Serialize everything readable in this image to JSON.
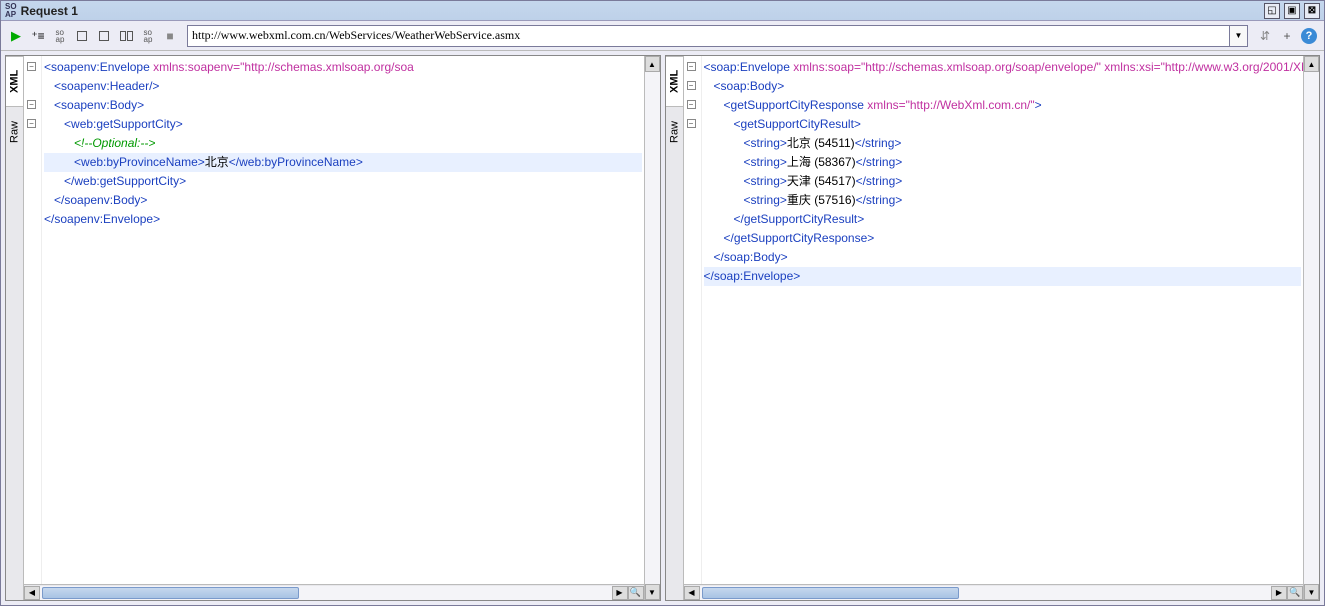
{
  "title": "Request 1",
  "titleIcon": "SO\nAP",
  "url": "http://www.webxml.com.cn/WebServices/WeatherWebService.asmx",
  "sideTabs": {
    "xml": "XML",
    "raw": "Raw"
  },
  "request": {
    "lines": [
      {
        "indent": 0,
        "type": "open",
        "tag": "soapenv:Envelope",
        "attrs": [
          {
            "n": "xmlns:soapenv",
            "v": "\"http://schemas.xmlsoap.org/soa"
          }
        ],
        "truncated": true,
        "fold": true
      },
      {
        "indent": 1,
        "type": "selfclose",
        "tag": "soapenv:Header"
      },
      {
        "indent": 1,
        "type": "open",
        "tag": "soapenv:Body",
        "fold": true
      },
      {
        "indent": 2,
        "type": "open",
        "tag": "web:getSupportCity",
        "fold": true
      },
      {
        "indent": 3,
        "type": "comment",
        "text": "<!--Optional:-->"
      },
      {
        "indent": 3,
        "type": "inline",
        "tag": "web:byProvinceName",
        "text": "北京",
        "highlight": true
      },
      {
        "indent": 2,
        "type": "close",
        "tag": "web:getSupportCity"
      },
      {
        "indent": 1,
        "type": "close",
        "tag": "soapenv:Body"
      },
      {
        "indent": 0,
        "type": "close",
        "tag": "soapenv:Envelope"
      }
    ]
  },
  "response": {
    "lines": [
      {
        "indent": 0,
        "type": "open",
        "tag": "soap:Envelope",
        "attrs": [
          {
            "n": "xmlns:soap",
            "v": "\"http://schemas.xmlsoap.org/soap/envelope/\""
          },
          {
            "n": "xmlns:xsi",
            "v": "\"http://www.w3.org/2001/XMLSche"
          }
        ],
        "truncated": true,
        "fold": true
      },
      {
        "indent": 1,
        "type": "open",
        "tag": "soap:Body",
        "fold": true
      },
      {
        "indent": 2,
        "type": "open",
        "tag": "getSupportCityResponse",
        "attrs": [
          {
            "n": "xmlns",
            "v": "\"http://WebXml.com.cn/\""
          }
        ],
        "fold": true
      },
      {
        "indent": 3,
        "type": "open",
        "tag": "getSupportCityResult",
        "fold": true
      },
      {
        "indent": 4,
        "type": "inline",
        "tag": "string",
        "text": "北京 (54511)"
      },
      {
        "indent": 4,
        "type": "inline",
        "tag": "string",
        "text": "上海 (58367)"
      },
      {
        "indent": 4,
        "type": "inline",
        "tag": "string",
        "text": "天津 (54517)"
      },
      {
        "indent": 4,
        "type": "inline",
        "tag": "string",
        "text": "重庆 (57516)"
      },
      {
        "indent": 3,
        "type": "close",
        "tag": "getSupportCityResult"
      },
      {
        "indent": 2,
        "type": "close",
        "tag": "getSupportCityResponse"
      },
      {
        "indent": 1,
        "type": "close",
        "tag": "soap:Body"
      },
      {
        "indent": 0,
        "type": "close",
        "tag": "soap:Envelope",
        "highlight": true
      }
    ]
  }
}
